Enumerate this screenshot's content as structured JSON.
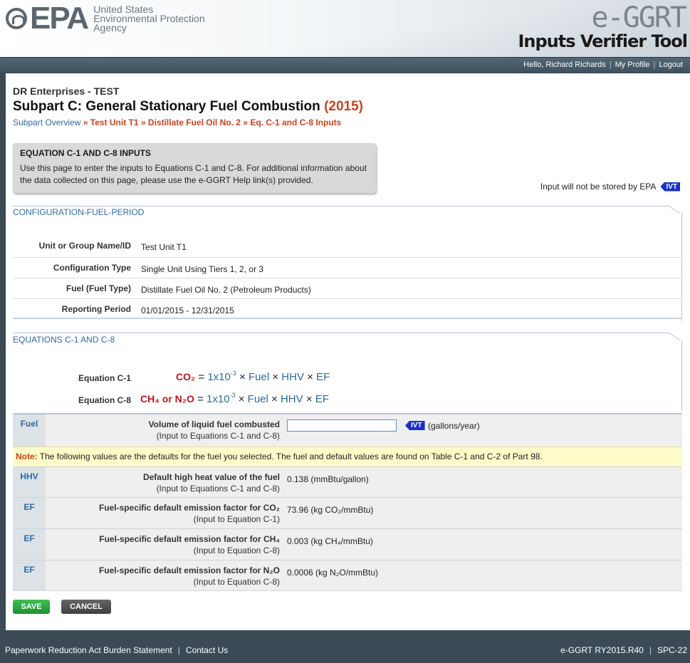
{
  "header": {
    "agency_lines": [
      "United States",
      "Environmental Protection",
      "Agency"
    ],
    "logo_text": "EPA",
    "app_name": "e-GGRT",
    "tool_name": "Inputs Verifier Tool"
  },
  "userbar": {
    "greeting": "Hello, Richard Richards",
    "my_profile": "My Profile",
    "logout": "Logout"
  },
  "page": {
    "company": "DR Enterprises - TEST",
    "subpart_title": "Subpart C: General Stationary Fuel Combustion",
    "year": "(2015)",
    "breadcrumb": {
      "overview": "Subpart Overview",
      "unit": "Test Unit T1",
      "fuel": "Distillate Fuel Oil No. 2",
      "current": "Eq. C-1 and C-8 Inputs",
      "sep": "»"
    }
  },
  "infobox": {
    "title": "EQUATION C-1 AND C-8 INPUTS",
    "description": "Use this page to enter the inputs to Equations C-1 and C-8. For additional information about the data collected on this page, please use the e-GGRT Help link(s) provided."
  },
  "ivt_notice": {
    "text": "Input will not be stored by EPA",
    "tag": "IVT"
  },
  "config": {
    "title": "CONFIGURATION-FUEL-PERIOD",
    "rows": [
      {
        "label": "Unit or Group Name/ID",
        "value": "Test Unit T1"
      },
      {
        "label": "Configuration Type",
        "value": "Single Unit Using Tiers 1, 2, or 3"
      },
      {
        "label": "Fuel (Fuel Type)",
        "value": "Distillate Fuel Oil No. 2 (Petroleum Products)"
      },
      {
        "label": "Reporting Period",
        "value": "01/01/2015 - 12/31/2015"
      }
    ]
  },
  "equations": {
    "title": "EQUATIONS C-1 AND C-8",
    "c1_label": "Equation C-1",
    "c8_label": "Equation C-8",
    "c1_lhs": "CO₂",
    "c8_lhs": "CH₄ or N₂O",
    "eq_sign": "=",
    "coef": "1x10",
    "exp": "-3",
    "times": "×",
    "fuel": "Fuel",
    "hhv": "HHV",
    "ef": "EF"
  },
  "inputs": {
    "fuel": {
      "key": "Fuel",
      "label": "Volume of liquid fuel combusted",
      "sub": "(Input to Equations C-1 and C-8)",
      "value": "",
      "tag": "IVT",
      "unit": "(gallons/year)"
    },
    "note_label": "Note:",
    "note_text": " The following values are the defaults for the fuel you selected. The fuel and default values are found on Table C-1 and C-2 of Part 98.",
    "hhv": {
      "key": "HHV",
      "label": "Default high heat value of the fuel",
      "sub": "(Input to Equations C-1 and C-8)",
      "value": "0.138 (mmBtu/gallon)"
    },
    "ef_co2": {
      "key": "EF",
      "label": "Fuel-specific default emission factor for CO₂",
      "sub": "(Input to Equation C-1)",
      "value": "73.96 (kg CO₂/mmBtu)"
    },
    "ef_ch4": {
      "key": "EF",
      "label": "Fuel-specific default emission factor for CH₄",
      "sub": "(Input to Equation C-8)",
      "value": "0.003 (kg CH₄/mmBtu)"
    },
    "ef_n2o": {
      "key": "EF",
      "label": "Fuel-specific default emission factor for N₂O",
      "sub": "(Input to Equation C-8)",
      "value": "0.0006 (kg N₂O/mmBtu)"
    }
  },
  "buttons": {
    "save": "SAVE",
    "cancel": "CANCEL"
  },
  "footer": {
    "burden": "Paperwork Reduction Act Burden Statement",
    "contact": "Contact Us",
    "version": "e-GGRT RY2015.R40",
    "screen_id": "SPC-22"
  }
}
